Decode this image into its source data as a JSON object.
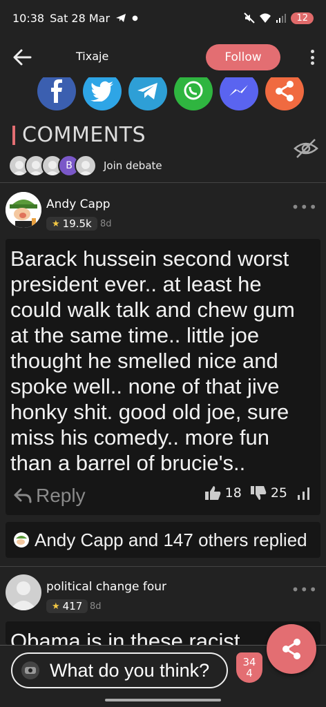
{
  "status_bar": {
    "time": "10:38",
    "date": "Sat 28 Mar",
    "battery": "12"
  },
  "header": {
    "title": "Tixaje",
    "follow_label": "Follow"
  },
  "share": {
    "buttons": [
      {
        "icon": "facebook-icon",
        "color": "#3b5fb0"
      },
      {
        "icon": "twitter-icon",
        "color": "#2ea5e6"
      },
      {
        "icon": "telegram-icon",
        "color": "#2e9fd6"
      },
      {
        "icon": "whatsapp-icon",
        "color": "#2fb540"
      },
      {
        "icon": "messenger-icon",
        "color": "#5a64f0"
      },
      {
        "icon": "share-icon",
        "color": "#f06a40"
      }
    ]
  },
  "comments": {
    "title": "COMMENTS",
    "join_label": "Join debate",
    "avatar_letter": "B",
    "items": [
      {
        "author": "Andy Capp",
        "score": "19.5k",
        "age": "8d",
        "text": "Barack hussein second worst president ever.. at least he could walk talk and chew gum at the same time.. little joe thought he smelled nice and spoke well.. none of that jive honky shit. good old joe, sure miss his comedy.. more fun than a barrel of brucie's..",
        "reply_label": "Reply",
        "upvotes": "18",
        "downvotes": "25",
        "replied_summary": "Andy Capp and 147 others replied"
      },
      {
        "author": "political change four",
        "score": "417",
        "age": "8d",
        "text": "Obama is in these racist"
      }
    ]
  },
  "composer": {
    "placeholder": "What do you think?",
    "count_top": "34",
    "count_bottom": "4"
  },
  "colors": {
    "accent": "#e36e72",
    "background": "#222222"
  }
}
